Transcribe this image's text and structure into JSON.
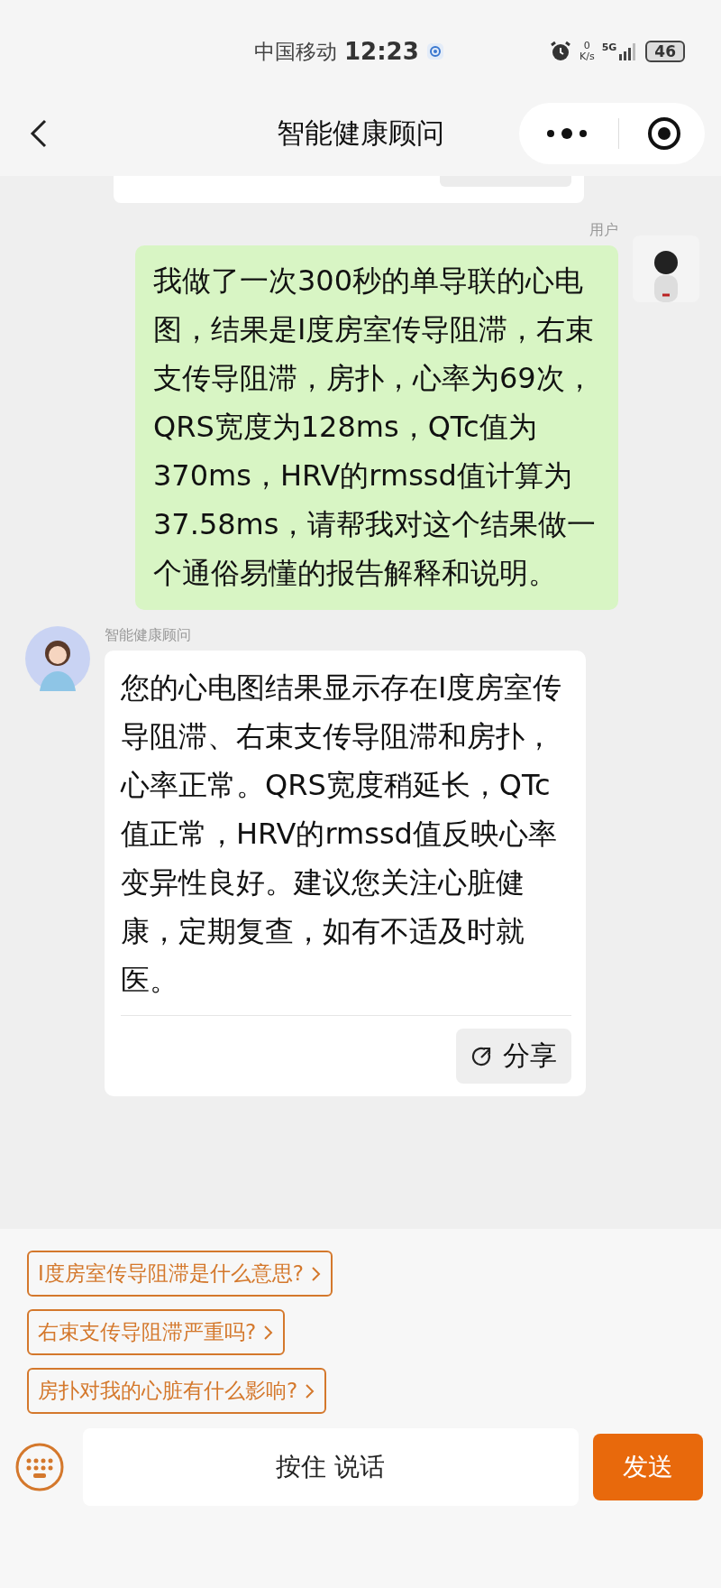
{
  "status_bar": {
    "carrier": "中国移动",
    "time": "12:23",
    "speed_value": "0",
    "speed_unit": "K/s",
    "network": "5G",
    "battery": "46"
  },
  "nav": {
    "title": "智能健康顾问"
  },
  "messages": [
    {
      "kind": "user",
      "sender": "用户",
      "text": "我做了一次300秒的单导联的心电图，结果是I度房室传导阻滞，右束支传导阻滞，房扑，心率为69次，QRS宽度为128ms，QTc值为370ms，HRV的rmssd值计算为37.58ms，请帮我对这个结果做一个通俗易懂的报告解释和说明。"
    },
    {
      "kind": "bot",
      "sender": "智能健康顾问",
      "text": "您的心电图结果显示存在I度房室传导阻滞、右束支传导阻滞和房扑，心率正常。QRS宽度稍延长，QTc值正常，HRV的rmssd值反映心率变异性良好。建议您关注心脏健康，定期复查，如有不适及时就医。",
      "share": "分享"
    }
  ],
  "suggestions": [
    "I度房室传导阻滞是什么意思?",
    "右束支传导阻滞严重吗?",
    "房扑对我的心脏有什么影响?"
  ],
  "input": {
    "voice_button": "按住 说话",
    "send_button": "发送"
  }
}
